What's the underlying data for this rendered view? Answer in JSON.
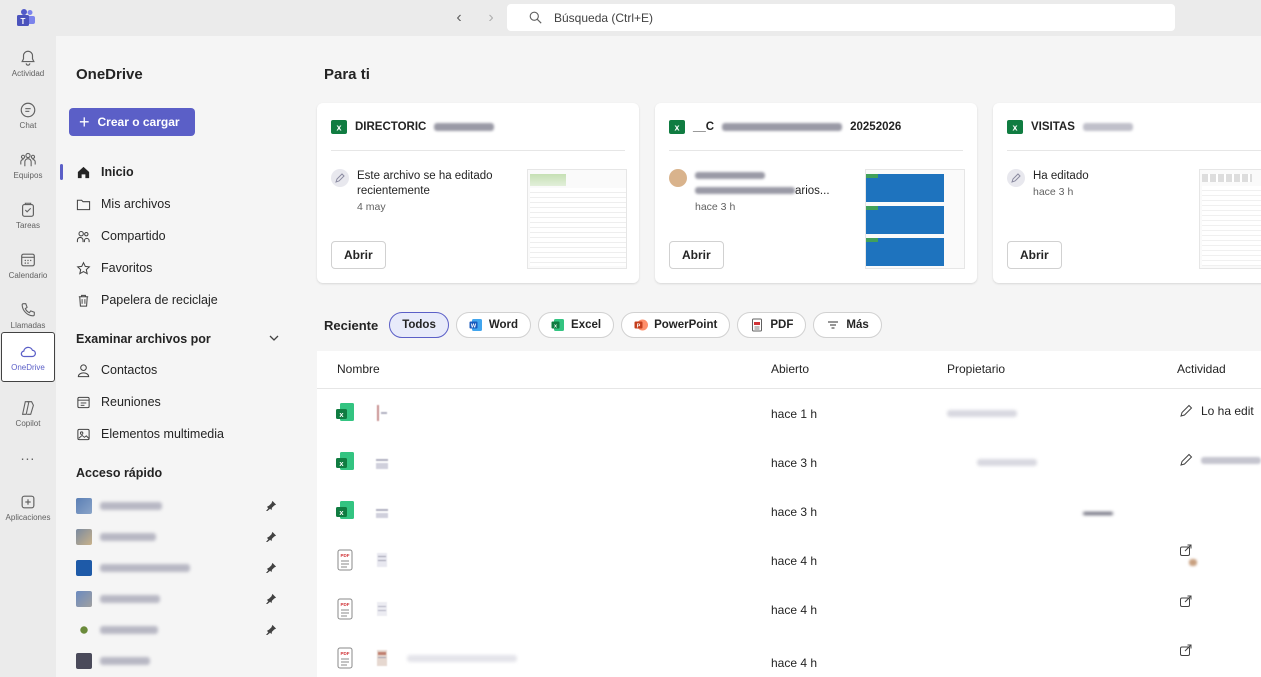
{
  "topbar": {
    "search_placeholder": "Búsqueda (Ctrl+E)"
  },
  "rail": {
    "items": [
      {
        "label": "Actividad",
        "icon": "bell-icon"
      },
      {
        "label": "Chat",
        "icon": "chat-icon"
      },
      {
        "label": "Equipos",
        "icon": "teams-icon"
      },
      {
        "label": "Tareas",
        "icon": "tasks-icon"
      },
      {
        "label": "Calendario",
        "icon": "calendar-icon"
      },
      {
        "label": "Llamadas",
        "icon": "phone-icon"
      },
      {
        "label": "OneDrive",
        "icon": "cloud-icon",
        "active": true
      },
      {
        "label": "Copilot",
        "icon": "copilot-icon"
      },
      {
        "label": "...",
        "icon": "more-icon"
      },
      {
        "label": "Aplicaciones",
        "icon": "add-apps-icon"
      }
    ]
  },
  "sidepane": {
    "title": "OneDrive",
    "create_label": "Crear o cargar",
    "nav": [
      {
        "label": "Inicio",
        "icon": "home-icon",
        "active": true
      },
      {
        "label": "Mis archivos",
        "icon": "folder-icon"
      },
      {
        "label": "Compartido",
        "icon": "people-icon"
      },
      {
        "label": "Favoritos",
        "icon": "star-icon"
      },
      {
        "label": "Papelera de reciclaje",
        "icon": "trash-icon"
      }
    ],
    "browse_title": "Examinar archivos por",
    "browse": [
      {
        "label": "Contactos",
        "icon": "contact-icon"
      },
      {
        "label": "Reuniones",
        "icon": "meeting-icon"
      },
      {
        "label": "Elementos multimedia",
        "icon": "media-icon"
      }
    ],
    "quick_title": "Acceso rápido"
  },
  "main": {
    "title": "Para ti",
    "cards": [
      {
        "file": "DIRECTORIC",
        "activity": "Este archivo se ha editado recientemente",
        "time": "4 may",
        "open": "Abrir"
      },
      {
        "file": "__C",
        "file_suffix": "20252026",
        "activity": "arios...",
        "time": "hace 3 h",
        "open": "Abrir"
      },
      {
        "file": "VISITAS",
        "activity": "Ha editado",
        "time": "hace 3 h",
        "open": "Abrir"
      }
    ],
    "filter_label": "Reciente",
    "filters": [
      {
        "label": "Todos",
        "selected": true
      },
      {
        "label": "Word",
        "icon": "word-icon"
      },
      {
        "label": "Excel",
        "icon": "excel-icon"
      },
      {
        "label": "PowerPoint",
        "icon": "powerpoint-icon"
      },
      {
        "label": "PDF",
        "icon": "pdf-icon"
      },
      {
        "label": "Más",
        "icon": "filter-lines-icon"
      }
    ],
    "columns": {
      "name": "Nombre",
      "opened": "Abierto",
      "owner": "Propietario",
      "activity": "Actividad"
    },
    "rows": [
      {
        "type": "excel",
        "opened": "hace 1 h",
        "activity": "Lo ha edit",
        "act_icon": "edit"
      },
      {
        "type": "excel",
        "opened": "hace 3 h",
        "activity": "",
        "act_icon": "edit"
      },
      {
        "type": "excel",
        "opened": "hace 3 h",
        "activity": "",
        "act_icon": ""
      },
      {
        "type": "pdf",
        "opened": "hace 4 h",
        "activity": "",
        "act_icon": "share"
      },
      {
        "type": "pdf",
        "opened": "hace 4 h",
        "activity": "",
        "act_icon": "share"
      },
      {
        "type": "pdf",
        "opened": "hace 4 h",
        "activity": "",
        "act_icon": "share"
      }
    ]
  }
}
